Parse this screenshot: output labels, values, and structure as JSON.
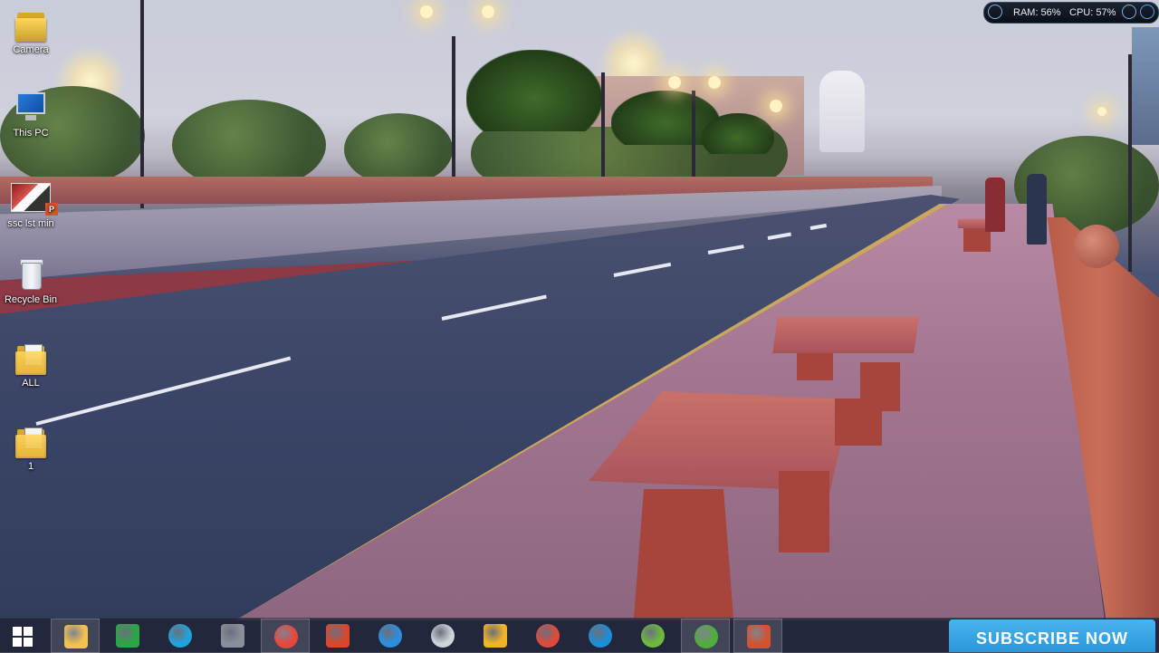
{
  "desktop": {
    "icons": [
      {
        "label": "Camera"
      },
      {
        "label": "This PC"
      },
      {
        "label": "ssc lst min"
      },
      {
        "label": "Recycle Bin"
      },
      {
        "label": "ALL"
      },
      {
        "label": "1"
      }
    ]
  },
  "system_monitor": {
    "ram_label": "RAM: 56%",
    "cpu_label": "CPU: 57%"
  },
  "taskbar": {
    "start_icon": "windows-logo-icon",
    "apps": [
      {
        "name": "file-explorer-icon",
        "color": "#f2c14e",
        "active": true
      },
      {
        "name": "store-icon",
        "color": "#29a745",
        "active": false
      },
      {
        "name": "sync-icon",
        "color": "#1fa3dd",
        "active": false
      },
      {
        "name": "video-tool-icon",
        "color": "#8a8f99",
        "active": false
      },
      {
        "name": "chrome-icon",
        "color": "#e9463b",
        "active": true
      },
      {
        "name": "ccleaner-icon",
        "color": "#d9472b",
        "active": false
      },
      {
        "name": "internet-explorer-icon",
        "color": "#2b8fe0",
        "active": false
      },
      {
        "name": "media-player-icon",
        "color": "#cfd3da",
        "active": false
      },
      {
        "name": "headphones-icon",
        "color": "#f0b428",
        "active": false
      },
      {
        "name": "music-app-icon",
        "color": "#e04a3a",
        "active": false
      },
      {
        "name": "download-manager-icon",
        "color": "#1a8fd8",
        "active": false
      },
      {
        "name": "green-app-icon",
        "color": "#6cbb3c",
        "active": false
      },
      {
        "name": "utorrent-icon",
        "color": "#4fae3b",
        "active": true
      },
      {
        "name": "powerpoint-icon",
        "color": "#d35230",
        "active": true
      }
    ]
  },
  "subscribe": {
    "label": "SUBSCRIBE NOW",
    "color": "#2a96dc"
  }
}
